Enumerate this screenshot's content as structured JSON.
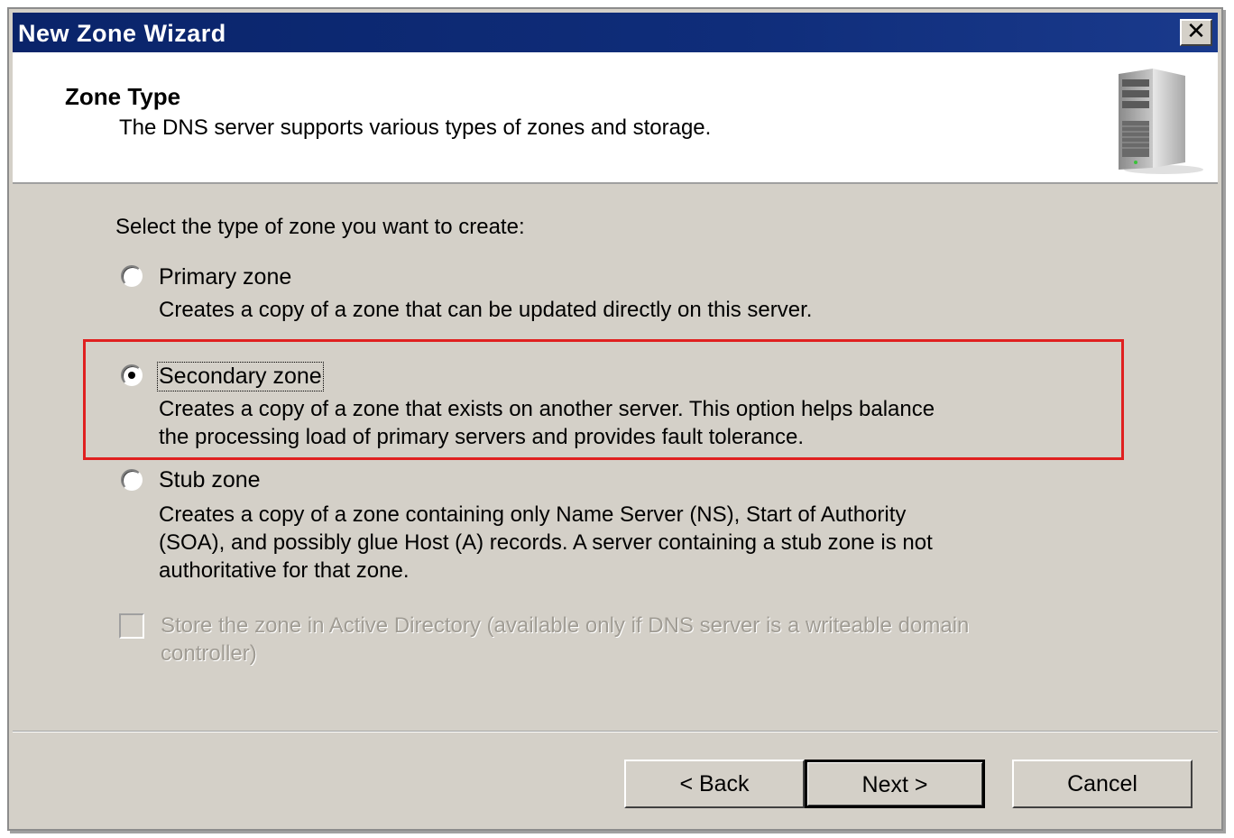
{
  "window": {
    "title": "New Zone Wizard",
    "close_glyph": "✕"
  },
  "header": {
    "title": "Zone Type",
    "subtitle": "The DNS server supports various types of zones and storage.",
    "icon": "server-tower-icon"
  },
  "body": {
    "prompt": "Select the type of zone you want to create:",
    "options": [
      {
        "label": "Primary zone",
        "description": "Creates a copy of a zone that can be updated directly on this server.",
        "selected": false
      },
      {
        "label": "Secondary zone",
        "description_line1": "Creates a copy of a zone that exists on another server. This option helps balance",
        "description_line2": "the processing load of primary servers and provides fault tolerance.",
        "selected": true
      },
      {
        "label": "Stub zone",
        "description_line1": "Creates a copy of a zone containing only Name Server (NS), Start of Authority",
        "description_line2": "(SOA), and possibly glue Host (A) records. A server containing a stub zone is not",
        "description_line3": "authoritative for that zone.",
        "selected": false
      }
    ],
    "store_ad": {
      "line1": "Store the zone in Active Directory (available only if DNS server is a writeable domain",
      "line2": "controller)",
      "checked": false,
      "enabled": false
    }
  },
  "buttons": {
    "back": "< Back",
    "next": "Next >",
    "cancel": "Cancel"
  },
  "colors": {
    "titlebar": "#0a246a",
    "highlight": "#e02020",
    "face": "#d4d0c8"
  }
}
